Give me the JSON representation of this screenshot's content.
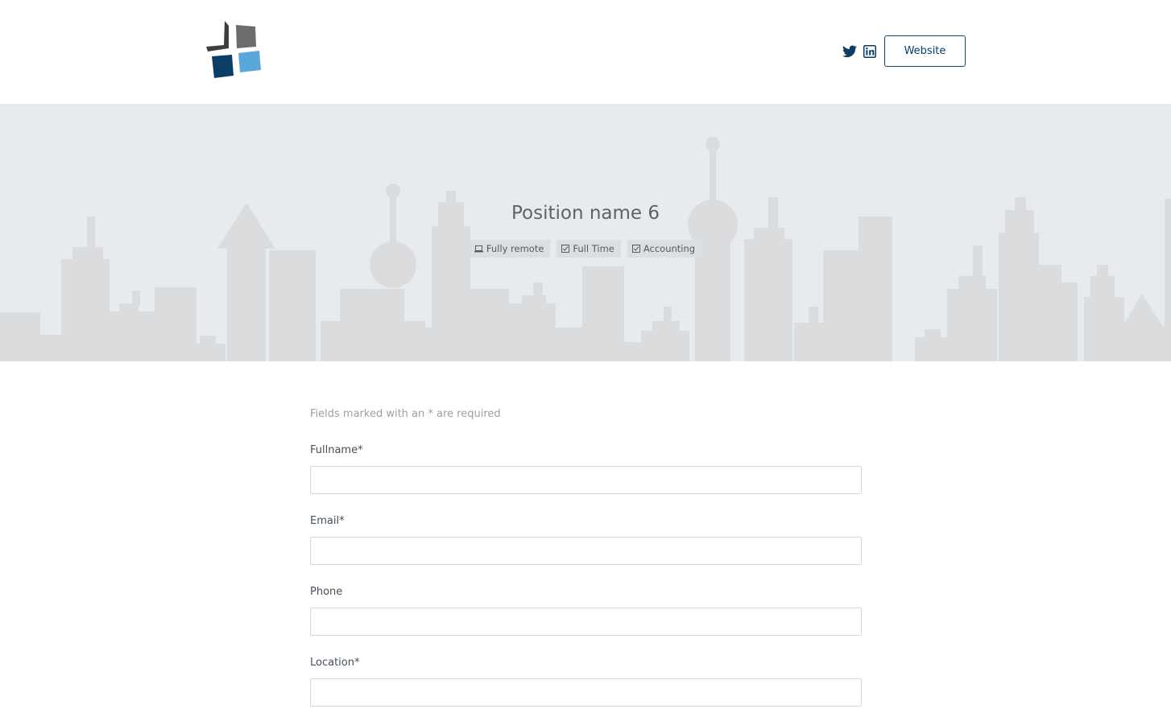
{
  "header": {
    "logo_icon": "company-logo",
    "social": [
      {
        "name": "twitter",
        "icon": "twitter-icon"
      },
      {
        "name": "linkedin",
        "icon": "linkedin-icon"
      }
    ],
    "website_label": "Website"
  },
  "hero": {
    "title": "Position name 6",
    "tags": [
      {
        "label": "Fully remote",
        "icon": "laptop-icon"
      },
      {
        "label": "Full Time",
        "icon": "checkbox-icon"
      },
      {
        "label": "Accounting",
        "icon": "checkbox-icon"
      }
    ]
  },
  "form": {
    "required_note": "Fields marked with an * are required",
    "fields": [
      {
        "label": "Fullname*",
        "value": "",
        "placeholder": ""
      },
      {
        "label": "Email*",
        "value": "",
        "placeholder": ""
      },
      {
        "label": "Phone",
        "value": "",
        "placeholder": ""
      },
      {
        "label": "Location*",
        "value": "",
        "placeholder": ""
      }
    ]
  },
  "colors": {
    "brand_dark": "#0b3e66",
    "brand_light": "#5aa7db",
    "logo_gray": "#6b6b6b",
    "hero_bg": "#e8ebee",
    "skyline": "#dadcde"
  }
}
